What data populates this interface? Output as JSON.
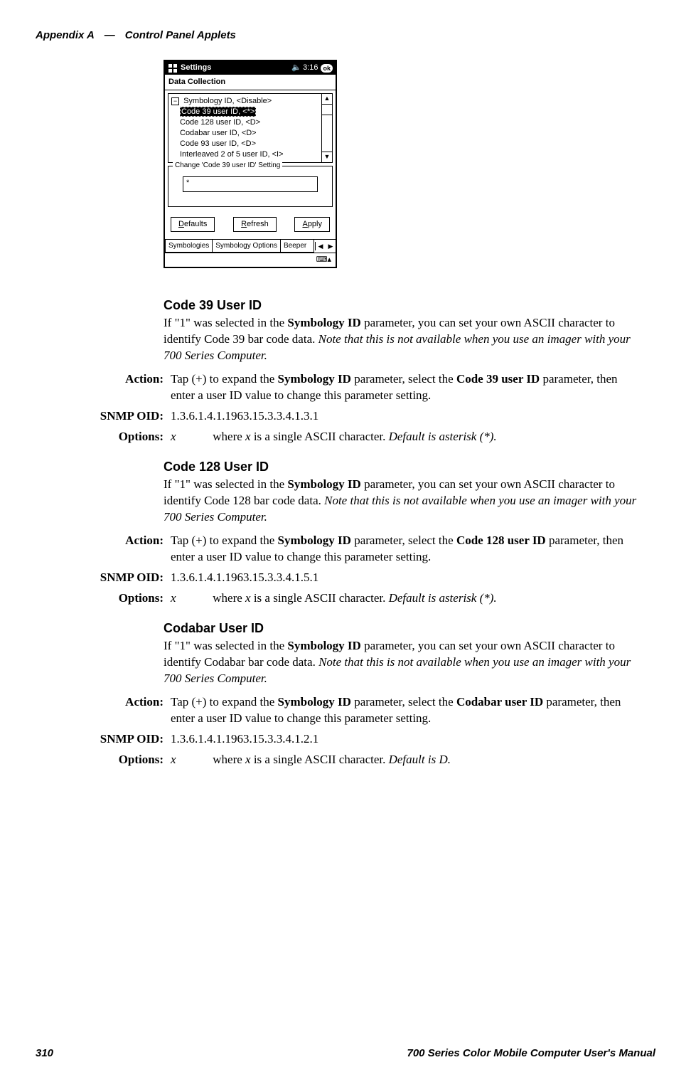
{
  "header": {
    "appendix": "Appendix  A",
    "dash": "—",
    "title": "Control Panel Applets"
  },
  "screenshot": {
    "titlebar": {
      "text": "Settings",
      "time": "3:16",
      "ok": "ok"
    },
    "subbar": "Data Collection",
    "tree": {
      "root": "Symbology ID, <Disable>",
      "items": [
        "Code 39 user ID, <*>",
        "Code 128 user ID, <D>",
        "Codabar user ID, <D>",
        "Code 93 user ID, <D>",
        "Interleaved 2 of 5 user ID, <I>"
      ],
      "selected_index": 0
    },
    "group_legend": "Change 'Code 39 user ID' Setting",
    "group_value": "*",
    "buttons": {
      "defaults": "Defaults",
      "refresh": "Refresh",
      "apply": "Apply"
    },
    "tabs": [
      "Symbologies",
      "Symbology Options",
      "Beeper"
    ]
  },
  "labels": {
    "action": "Action:",
    "snmp": "SNMP OID:",
    "options": "Options:"
  },
  "sections": [
    {
      "title": "Code 39 User ID",
      "intro_a": "If \"1\" was selected in the ",
      "intro_b": "Symbology ID",
      "intro_c": " parameter, you can set your own ASCII character to identify Code 39 bar code data. ",
      "intro_note": "Note that this is not available when you use an imager with your 700 Series Computer.",
      "action_a": "Tap (+) to expand the ",
      "action_b": "Symbology ID",
      "action_c": " parameter, select the ",
      "action_d": "Code 39 user ID",
      "action_e": " parameter, then enter a user ID value to change this parameter setting.",
      "snmp": "1.3.6.1.4.1.1963.15.3.3.4.1.3.1",
      "opt_x": "x",
      "opt_a": "where ",
      "opt_b": "x",
      "opt_c": " is a single ASCII character. ",
      "opt_d": "Default is asterisk (*)."
    },
    {
      "title": "Code 128 User ID",
      "intro_a": "If \"1\" was selected in the ",
      "intro_b": "Symbology ID",
      "intro_c": " parameter, you can set your own ASCII character to identify Code 128 bar code data. ",
      "intro_note": "Note that this is not available when you use an imager with your 700 Series Computer.",
      "action_a": "Tap (+) to expand the ",
      "action_b": "Symbology ID",
      "action_c": " parameter, select the ",
      "action_d": "Code 128 user ID",
      "action_e": " parameter, then enter a user ID value to change this parameter setting.",
      "snmp": "1.3.6.1.4.1.1963.15.3.3.4.1.5.1",
      "opt_x": "x",
      "opt_a": "where ",
      "opt_b": "x",
      "opt_c": " is a single ASCII character. ",
      "opt_d": "Default is asterisk (*)."
    },
    {
      "title": "Codabar User ID",
      "intro_a": "If \"1\" was selected in the ",
      "intro_b": "Symbology ID",
      "intro_c": " parameter, you can set your own ASCII character to identify Codabar bar code data. ",
      "intro_note": "Note that this is not available when you use an imager with your 700 Series Computer.",
      "action_a": "Tap (+) to expand the ",
      "action_b": "Symbology ID",
      "action_c": " parameter, select the ",
      "action_d": "Codabar user ID",
      "action_e": " parameter, then enter a user ID value to change this parameter setting.",
      "snmp": "1.3.6.1.4.1.1963.15.3.3.4.1.2.1",
      "opt_x": "x",
      "opt_a": "where ",
      "opt_b": "x",
      "opt_c": " is a single ASCII character. ",
      "opt_d": "Default is D."
    }
  ],
  "footer": {
    "page": "310",
    "book": "700 Series Color Mobile Computer User's Manual"
  }
}
